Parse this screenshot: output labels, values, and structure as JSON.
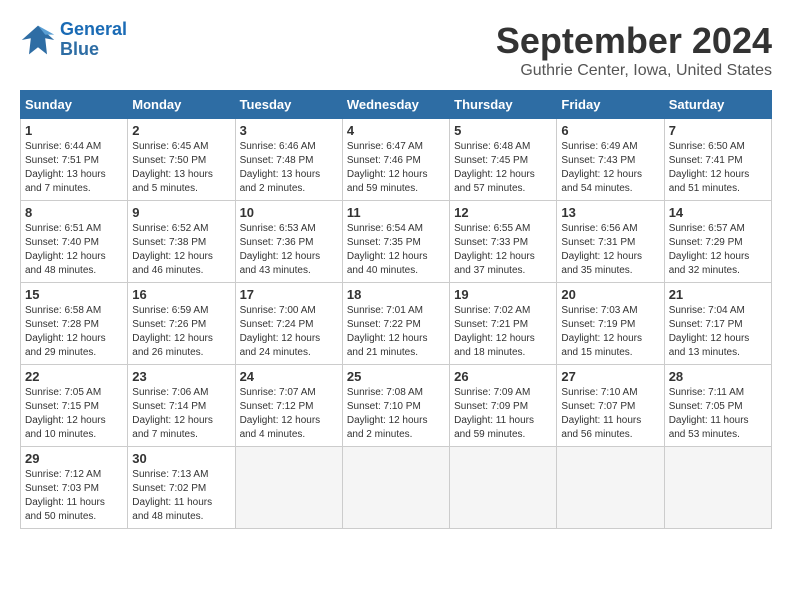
{
  "header": {
    "logo_line1": "General",
    "logo_line2": "Blue",
    "month": "September 2024",
    "location": "Guthrie Center, Iowa, United States"
  },
  "weekdays": [
    "Sunday",
    "Monday",
    "Tuesday",
    "Wednesday",
    "Thursday",
    "Friday",
    "Saturday"
  ],
  "weeks": [
    [
      {
        "day": "1",
        "info": "Sunrise: 6:44 AM\nSunset: 7:51 PM\nDaylight: 13 hours and 7 minutes."
      },
      {
        "day": "2",
        "info": "Sunrise: 6:45 AM\nSunset: 7:50 PM\nDaylight: 13 hours and 5 minutes."
      },
      {
        "day": "3",
        "info": "Sunrise: 6:46 AM\nSunset: 7:48 PM\nDaylight: 13 hours and 2 minutes."
      },
      {
        "day": "4",
        "info": "Sunrise: 6:47 AM\nSunset: 7:46 PM\nDaylight: 12 hours and 59 minutes."
      },
      {
        "day": "5",
        "info": "Sunrise: 6:48 AM\nSunset: 7:45 PM\nDaylight: 12 hours and 57 minutes."
      },
      {
        "day": "6",
        "info": "Sunrise: 6:49 AM\nSunset: 7:43 PM\nDaylight: 12 hours and 54 minutes."
      },
      {
        "day": "7",
        "info": "Sunrise: 6:50 AM\nSunset: 7:41 PM\nDaylight: 12 hours and 51 minutes."
      }
    ],
    [
      {
        "day": "8",
        "info": "Sunrise: 6:51 AM\nSunset: 7:40 PM\nDaylight: 12 hours and 48 minutes."
      },
      {
        "day": "9",
        "info": "Sunrise: 6:52 AM\nSunset: 7:38 PM\nDaylight: 12 hours and 46 minutes."
      },
      {
        "day": "10",
        "info": "Sunrise: 6:53 AM\nSunset: 7:36 PM\nDaylight: 12 hours and 43 minutes."
      },
      {
        "day": "11",
        "info": "Sunrise: 6:54 AM\nSunset: 7:35 PM\nDaylight: 12 hours and 40 minutes."
      },
      {
        "day": "12",
        "info": "Sunrise: 6:55 AM\nSunset: 7:33 PM\nDaylight: 12 hours and 37 minutes."
      },
      {
        "day": "13",
        "info": "Sunrise: 6:56 AM\nSunset: 7:31 PM\nDaylight: 12 hours and 35 minutes."
      },
      {
        "day": "14",
        "info": "Sunrise: 6:57 AM\nSunset: 7:29 PM\nDaylight: 12 hours and 32 minutes."
      }
    ],
    [
      {
        "day": "15",
        "info": "Sunrise: 6:58 AM\nSunset: 7:28 PM\nDaylight: 12 hours and 29 minutes."
      },
      {
        "day": "16",
        "info": "Sunrise: 6:59 AM\nSunset: 7:26 PM\nDaylight: 12 hours and 26 minutes."
      },
      {
        "day": "17",
        "info": "Sunrise: 7:00 AM\nSunset: 7:24 PM\nDaylight: 12 hours and 24 minutes."
      },
      {
        "day": "18",
        "info": "Sunrise: 7:01 AM\nSunset: 7:22 PM\nDaylight: 12 hours and 21 minutes."
      },
      {
        "day": "19",
        "info": "Sunrise: 7:02 AM\nSunset: 7:21 PM\nDaylight: 12 hours and 18 minutes."
      },
      {
        "day": "20",
        "info": "Sunrise: 7:03 AM\nSunset: 7:19 PM\nDaylight: 12 hours and 15 minutes."
      },
      {
        "day": "21",
        "info": "Sunrise: 7:04 AM\nSunset: 7:17 PM\nDaylight: 12 hours and 13 minutes."
      }
    ],
    [
      {
        "day": "22",
        "info": "Sunrise: 7:05 AM\nSunset: 7:15 PM\nDaylight: 12 hours and 10 minutes."
      },
      {
        "day": "23",
        "info": "Sunrise: 7:06 AM\nSunset: 7:14 PM\nDaylight: 12 hours and 7 minutes."
      },
      {
        "day": "24",
        "info": "Sunrise: 7:07 AM\nSunset: 7:12 PM\nDaylight: 12 hours and 4 minutes."
      },
      {
        "day": "25",
        "info": "Sunrise: 7:08 AM\nSunset: 7:10 PM\nDaylight: 12 hours and 2 minutes."
      },
      {
        "day": "26",
        "info": "Sunrise: 7:09 AM\nSunset: 7:09 PM\nDaylight: 11 hours and 59 minutes."
      },
      {
        "day": "27",
        "info": "Sunrise: 7:10 AM\nSunset: 7:07 PM\nDaylight: 11 hours and 56 minutes."
      },
      {
        "day": "28",
        "info": "Sunrise: 7:11 AM\nSunset: 7:05 PM\nDaylight: 11 hours and 53 minutes."
      }
    ],
    [
      {
        "day": "29",
        "info": "Sunrise: 7:12 AM\nSunset: 7:03 PM\nDaylight: 11 hours and 50 minutes."
      },
      {
        "day": "30",
        "info": "Sunrise: 7:13 AM\nSunset: 7:02 PM\nDaylight: 11 hours and 48 minutes."
      },
      null,
      null,
      null,
      null,
      null
    ]
  ]
}
